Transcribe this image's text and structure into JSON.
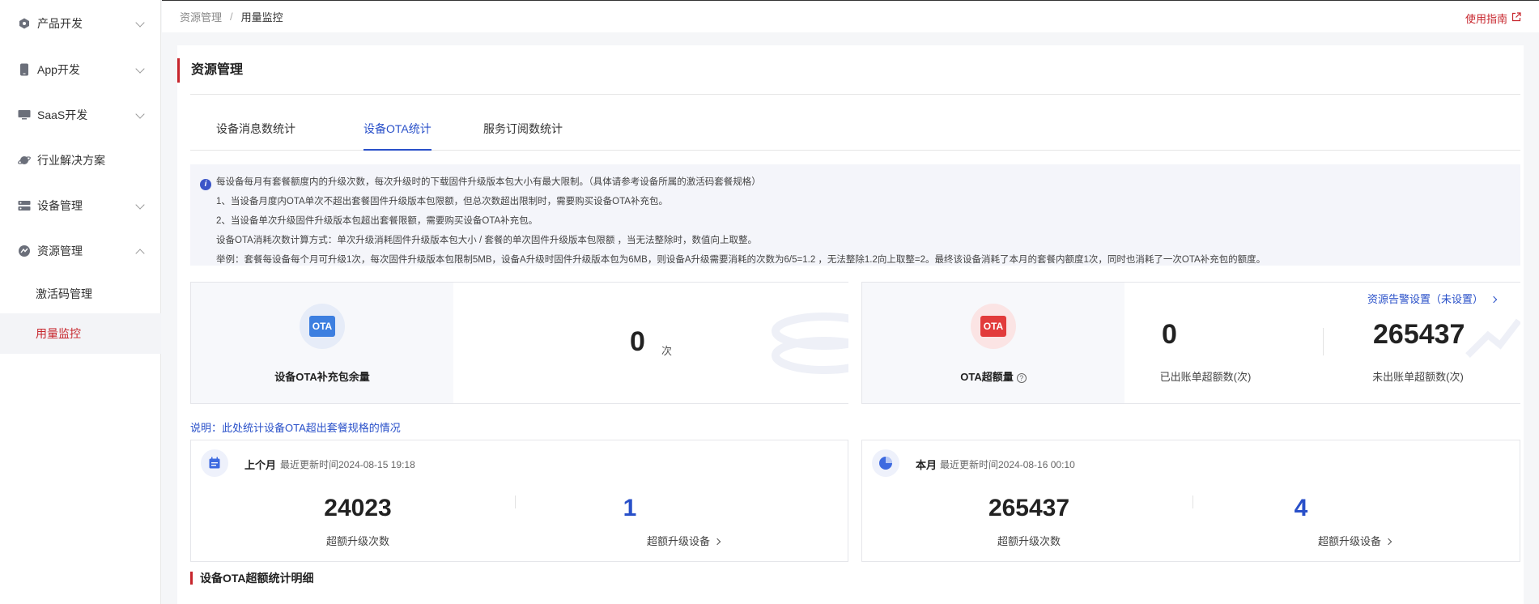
{
  "sidebar": {
    "items": [
      {
        "label": "产品开发",
        "icon": "hexagon-icon"
      },
      {
        "label": "App开发",
        "icon": "phone-icon"
      },
      {
        "label": "SaaS开发",
        "icon": "monitor-icon"
      },
      {
        "label": "行业解决方案",
        "icon": "planet-icon"
      },
      {
        "label": "设备管理",
        "icon": "server-icon"
      },
      {
        "label": "资源管理",
        "icon": "resource-icon"
      }
    ],
    "sub_items": [
      {
        "label": "激活码管理"
      },
      {
        "label": "用量监控"
      }
    ]
  },
  "breadcrumb": {
    "parent": "资源管理",
    "separator": "/",
    "current": "用量监控"
  },
  "guide_link": "使用指南",
  "section_title": "资源管理",
  "tabs": [
    {
      "label": "设备消息数统计"
    },
    {
      "label": "设备OTA统计"
    },
    {
      "label": "服务订阅数统计"
    }
  ],
  "notice": {
    "lines": [
      "每设备每月有套餐额度内的升级次数，每次升级时的下载固件升级版本包大小有最大限制。（具体请参考设备所属的激活码套餐规格）",
      "1、当设备月度内OTA单次不超出套餐固件升级版本包限额，但总次数超出限制时，需要购买设备OTA补充包。",
      "2、当设备单次升级固件升级版本包超出套餐限额，需要购买设备OTA补充包。",
      "设备OTA消耗次数计算方式：单次升级消耗固件升级版本包大小 / 套餐的单次固件升级版本包限额 ，当无法整除时，数值向上取整。",
      "举例：套餐每设备每个月可升级1次，每次固件升级版本包限制5MB，设备A升级时固件升级版本包为6MB，则设备A升级需要消耗的次数为6/5=1.2 ，无法整除1.2向上取整=2。最终该设备消耗了本月的套餐内额度1次，同时也消耗了一次OTA补充包的额度。"
    ]
  },
  "supplement": {
    "badge": "OTA",
    "label": "设备OTA补充包余量",
    "value": "0",
    "unit": "次"
  },
  "excess": {
    "badge": "OTA",
    "label": "OTA超额量",
    "help": "?",
    "alert_link": "资源告警设置（未设置）",
    "billed_value": "0",
    "billed_label": "已出账单超额数(次)",
    "unbilled_value": "265437",
    "unbilled_label": "未出账单超额数(次)"
  },
  "explain": "说明：此处统计设备OTA超出套餐规格的情况",
  "last_month": {
    "title": "上个月",
    "updated": "最近更新时间2024-08-15 19:18",
    "count": "24023",
    "count_label": "超额升级次数",
    "devices": "1",
    "devices_label": "超额升级设备"
  },
  "this_month": {
    "title": "本月",
    "updated": "最近更新时间2024-08-16 00:10",
    "count": "265437",
    "count_label": "超额升级次数",
    "devices": "4",
    "devices_label": "超额升级设备"
  },
  "detail_title": "设备OTA超额统计明细",
  "colors": {
    "accent_red": "#c7252c",
    "accent_blue": "#2950c9"
  }
}
